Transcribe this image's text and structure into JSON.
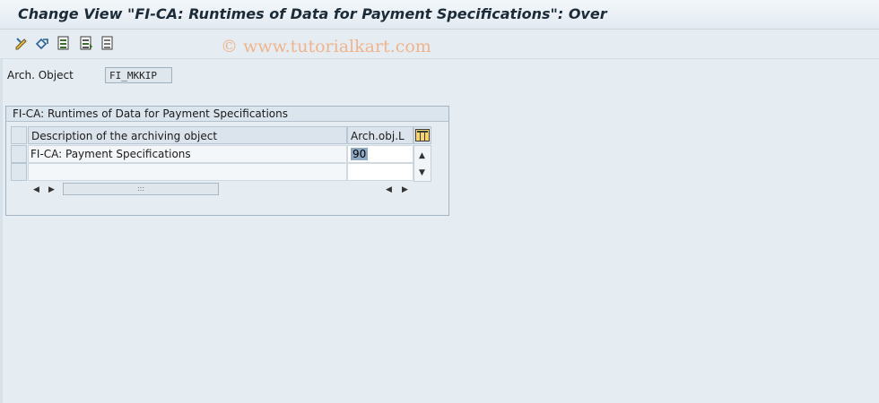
{
  "window": {
    "title": "Change View \"FI-CA: Runtimes of Data for Payment Specifications\": Over"
  },
  "toolbar": {
    "buttons": [
      {
        "icon": "display-change-icon"
      },
      {
        "icon": "other-view-icon"
      },
      {
        "icon": "select-all-icon"
      },
      {
        "icon": "select-block-icon"
      },
      {
        "icon": "deselect-all-icon"
      }
    ],
    "watermark": "© www.tutorialkart.com"
  },
  "header_field": {
    "label": "Arch. Object",
    "value": "FI_MKKIP"
  },
  "group": {
    "title": "FI-CA: Runtimes of Data for Payment Specifications"
  },
  "table": {
    "columns": [
      "Description of the archiving object",
      "Arch.obj.L"
    ],
    "rows": [
      {
        "description": "FI-CA: Payment Specifications",
        "runtime": "90"
      },
      {
        "description": "",
        "runtime": ""
      }
    ],
    "settings_icon": "table-settings-icon"
  },
  "colors": {
    "background": "#e5edf3",
    "selected_input": "#8da9c3",
    "watermark": "#f0b48c"
  }
}
